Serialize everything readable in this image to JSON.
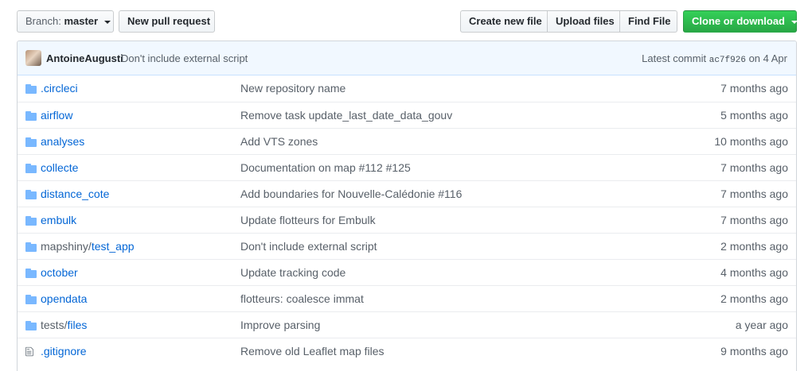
{
  "toolbar": {
    "branch_label": "Branch:",
    "branch_name": "master",
    "new_pr": "New pull request",
    "create_file": "Create new file",
    "upload_files": "Upload files",
    "find_file": "Find File",
    "clone": "Clone or download"
  },
  "commit": {
    "author": "AntoineAugusti",
    "message": "Don't include external script",
    "latest_label": "Latest commit",
    "sha": "ac7f926",
    "date": "on 4 Apr"
  },
  "files": [
    {
      "prefix": "",
      "name": ".circleci",
      "type": "dir",
      "message": "New repository name",
      "age": "7 months ago"
    },
    {
      "prefix": "",
      "name": "airflow",
      "type": "dir",
      "message": "Remove task update_last_date_data_gouv",
      "age": "5 months ago"
    },
    {
      "prefix": "",
      "name": "analyses",
      "type": "dir",
      "message": "Add VTS zones",
      "age": "10 months ago"
    },
    {
      "prefix": "",
      "name": "collecte",
      "type": "dir",
      "message": "Documentation on map #112 #125",
      "age": "7 months ago"
    },
    {
      "prefix": "",
      "name": "distance_cote",
      "type": "dir",
      "message": "Add boundaries for Nouvelle-Calédonie #116",
      "age": "7 months ago"
    },
    {
      "prefix": "",
      "name": "embulk",
      "type": "dir",
      "message": "Update flotteurs for Embulk",
      "age": "7 months ago"
    },
    {
      "prefix": "mapshiny/",
      "name": "test_app",
      "type": "dir",
      "message": "Don't include external script",
      "age": "2 months ago"
    },
    {
      "prefix": "",
      "name": "october",
      "type": "dir",
      "message": "Update tracking code",
      "age": "4 months ago"
    },
    {
      "prefix": "",
      "name": "opendata",
      "type": "dir",
      "message": "flotteurs: coalesce immat",
      "age": "2 months ago"
    },
    {
      "prefix": "tests/",
      "name": "files",
      "type": "dir",
      "message": "Improve parsing",
      "age": "a year ago"
    },
    {
      "prefix": "",
      "name": ".gitignore",
      "type": "file",
      "message": "Remove old Leaflet map files",
      "age": "9 months ago"
    }
  ],
  "colors": {
    "link": "#0366d6",
    "muted": "#586069",
    "folder": "#79b8ff",
    "green": "#28a745"
  }
}
